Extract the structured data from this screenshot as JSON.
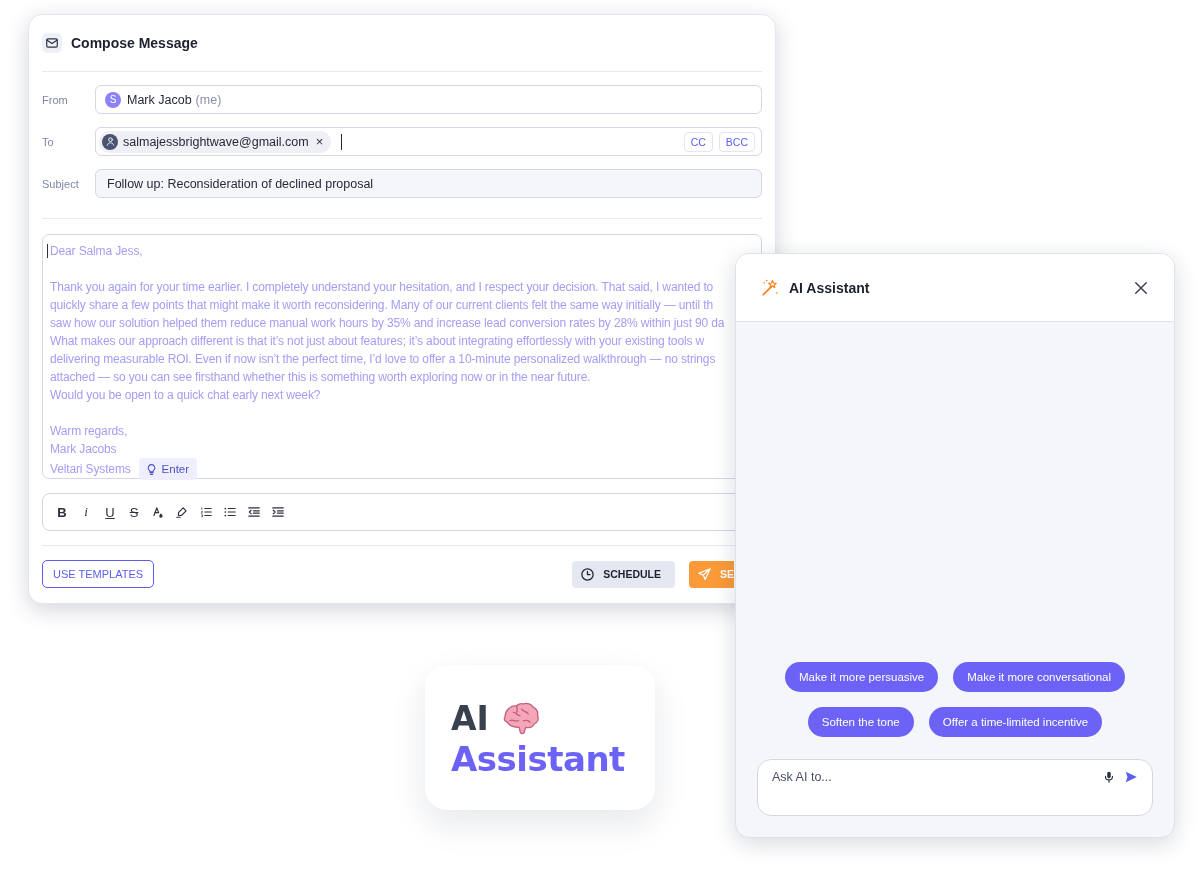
{
  "compose": {
    "title": "Compose Message",
    "from": {
      "label": "From",
      "avatar": "S",
      "name": "Mark Jacob",
      "note": "(me)"
    },
    "to": {
      "label": "To",
      "recipients": [
        {
          "email": "salmajessbrightwave@gmail.com",
          "remove": "×"
        }
      ],
      "cc": "CC",
      "bcc": "BCC"
    },
    "subject": {
      "label": "Subject",
      "value": "Follow up: Reconsideration of declined proposal"
    },
    "body": {
      "greeting": "Dear Salma Jess,",
      "paragraph": [
        "Thank you again for your time earlier. I completely understand your hesitation, and I respect your decision. That said, I wanted to",
        "quickly share a few points that might make it worth reconsidering. Many of our current clients felt the same way initially — until th",
        "saw how our solution helped them reduce manual work hours by 35% and increase lead conversion rates by 28% within just 90 da",
        "What makes our approach different is that it’s not just about features; it’s about integrating effortlessly with your existing tools w",
        "delivering measurable ROI. Even if now isn’t the perfect time, I’d love to offer a 10-minute personalized walkthrough — no strings",
        "attached — so you can see firsthand whether this is something worth exploring now or in the near future.",
        "Would you be open to a quick chat early next week?"
      ],
      "closing": [
        "Warm regards,",
        "Mark Jacobs",
        "Veltari Systems"
      ],
      "suggestion": "Enter"
    },
    "toolbar": [
      {
        "kind": "bold",
        "label": "B"
      },
      {
        "kind": "italic",
        "label": "i"
      },
      {
        "kind": "underline",
        "label": "U"
      },
      {
        "kind": "strike",
        "label": "S"
      },
      {
        "kind": "text-color"
      },
      {
        "kind": "highlight"
      },
      {
        "kind": "numbered-list"
      },
      {
        "kind": "bullet-list"
      },
      {
        "kind": "outdent"
      },
      {
        "kind": "indent"
      }
    ],
    "actions": {
      "templates": "USE TEMPLATES",
      "schedule": "SCHEDULE",
      "send": "SE"
    }
  },
  "assistant": {
    "title": "AI Assistant",
    "suggestions": [
      [
        "Make it more persuasive",
        "Make it more conversational"
      ],
      [
        "Soften the tone",
        "Offer a time-limited incentive"
      ]
    ],
    "input": {
      "placeholder": "Ask AI to..."
    }
  },
  "badge": {
    "line1": "AI",
    "line2": "Assistant"
  }
}
